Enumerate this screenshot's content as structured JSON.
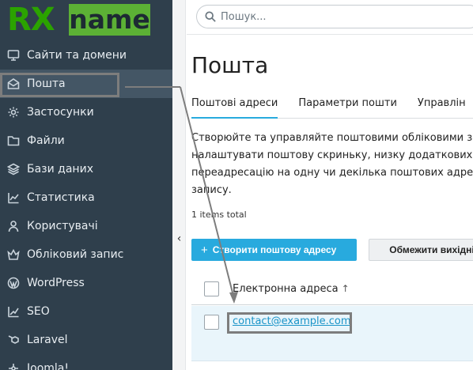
{
  "logo": {
    "part1": "RX",
    "part2": "name"
  },
  "search": {
    "placeholder": "Пошук..."
  },
  "sidebar": {
    "items": [
      {
        "label": "Сайти та домени",
        "icon": "monitor-icon"
      },
      {
        "label": "Пошта",
        "icon": "mail-icon",
        "active": true
      },
      {
        "label": "Застосунки",
        "icon": "gear-icon"
      },
      {
        "label": "Файли",
        "icon": "folder-icon"
      },
      {
        "label": "Бази даних",
        "icon": "layers-icon"
      },
      {
        "label": "Статистика",
        "icon": "chart-icon"
      },
      {
        "label": "Користувачі",
        "icon": "user-icon"
      },
      {
        "label": "Обліковий запис",
        "icon": "crown-icon"
      },
      {
        "label": "WordPress",
        "icon": "wordpress-icon"
      },
      {
        "label": "SEO",
        "icon": "seo-icon"
      },
      {
        "label": "Laravel",
        "icon": "laravel-icon"
      },
      {
        "label": "Joomla!",
        "icon": "joomla-icon"
      }
    ]
  },
  "main": {
    "title": "Пошта",
    "tabs": [
      {
        "label": "Поштові адреси",
        "active": true
      },
      {
        "label": "Параметри пошти"
      },
      {
        "label": "Управлін"
      }
    ],
    "description": [
      "Створюйте та управляйте поштовими обліковими за",
      "налаштувати поштову скриньку, низку додаткових п",
      "переадресацію на одну чи декілька поштових адрес",
      "запису."
    ],
    "total": "1 items total",
    "create_button": "Створити поштову адресу",
    "limit_button": "Обмежити вихідні",
    "table": {
      "column": "Електронна адреса",
      "sort_indicator": "↑",
      "rows": [
        {
          "email": "contact@example.com"
        }
      ]
    }
  },
  "colors": {
    "sidebar": "#2f3f4c",
    "accent": "#28aade",
    "logo_green": "#5cb135"
  }
}
